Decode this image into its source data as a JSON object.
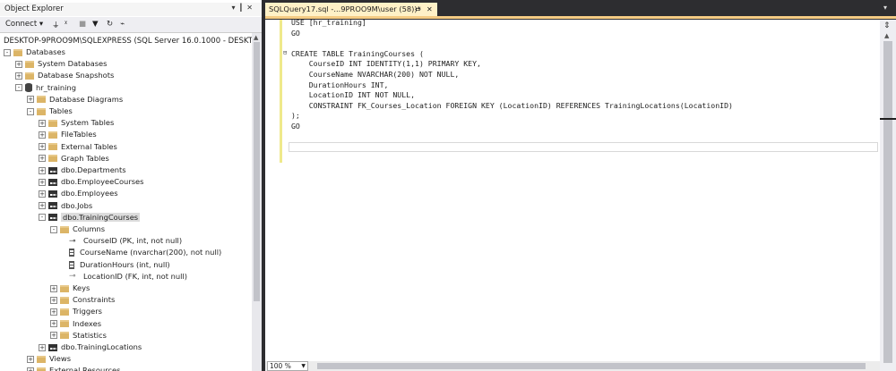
{
  "object_explorer": {
    "title": "Object Explorer",
    "title_buttons": [
      "▾",
      "📌",
      "✕"
    ],
    "toolbar": {
      "connect_label": "Connect ▾",
      "icons": [
        "connect-icon",
        "disconnect-icon",
        "stop-icon",
        "filter-icon",
        "refresh-icon",
        "activity-icon"
      ]
    },
    "server": "DESKTOP-9PROO9M\\SQLEXPRESS (SQL Server 16.0.1000 - DESKTOP-9P",
    "tree": [
      {
        "label": "Databases",
        "level": 0,
        "icon": "folder",
        "exp": "-"
      },
      {
        "label": "System Databases",
        "level": 1,
        "icon": "folder",
        "exp": "+"
      },
      {
        "label": "Database Snapshots",
        "level": 1,
        "icon": "folder",
        "exp": "+"
      },
      {
        "label": "hr_training",
        "level": 1,
        "icon": "database",
        "exp": "-"
      },
      {
        "label": "Database Diagrams",
        "level": 2,
        "icon": "folder",
        "exp": "+"
      },
      {
        "label": "Tables",
        "level": 2,
        "icon": "folder",
        "exp": "-"
      },
      {
        "label": "System Tables",
        "level": 3,
        "icon": "folder",
        "exp": "+"
      },
      {
        "label": "FileTables",
        "level": 3,
        "icon": "folder",
        "exp": "+"
      },
      {
        "label": "External Tables",
        "level": 3,
        "icon": "folder",
        "exp": "+"
      },
      {
        "label": "Graph Tables",
        "level": 3,
        "icon": "folder",
        "exp": "+"
      },
      {
        "label": "dbo.Departments",
        "level": 3,
        "icon": "table",
        "exp": "+"
      },
      {
        "label": "dbo.EmployeeCourses",
        "level": 3,
        "icon": "table",
        "exp": "+"
      },
      {
        "label": "dbo.Employees",
        "level": 3,
        "icon": "table",
        "exp": "+"
      },
      {
        "label": "dbo.Jobs",
        "level": 3,
        "icon": "table",
        "exp": "+"
      },
      {
        "label": "dbo.TrainingCourses",
        "level": 3,
        "icon": "table",
        "exp": "-",
        "selected": true
      },
      {
        "label": "Columns",
        "level": 4,
        "icon": "folder",
        "exp": "-"
      },
      {
        "label": "CourseID (PK, int, not null)",
        "level": 5,
        "icon": "pk",
        "exp": ""
      },
      {
        "label": "CourseName (nvarchar(200), not null)",
        "level": 5,
        "icon": "column",
        "exp": ""
      },
      {
        "label": "DurationHours (int, null)",
        "level": 5,
        "icon": "column",
        "exp": ""
      },
      {
        "label": "LocationID (FK, int, not null)",
        "level": 5,
        "icon": "fk",
        "exp": ""
      },
      {
        "label": "Keys",
        "level": 4,
        "icon": "folder",
        "exp": "+"
      },
      {
        "label": "Constraints",
        "level": 4,
        "icon": "folder",
        "exp": "+"
      },
      {
        "label": "Triggers",
        "level": 4,
        "icon": "folder",
        "exp": "+"
      },
      {
        "label": "Indexes",
        "level": 4,
        "icon": "folder",
        "exp": "+"
      },
      {
        "label": "Statistics",
        "level": 4,
        "icon": "folder",
        "exp": "+"
      },
      {
        "label": "dbo.TrainingLocations",
        "level": 3,
        "icon": "table",
        "exp": "+"
      },
      {
        "label": "Views",
        "level": 2,
        "icon": "folder",
        "exp": "+"
      },
      {
        "label": "External Resources",
        "level": 2,
        "icon": "folder",
        "exp": "+"
      }
    ]
  },
  "editor": {
    "tab_title": "SQLQuery17.sql -...9PROO9M\\user (58))*",
    "tab_pin": "⇔",
    "tab_close": "✕",
    "code_lines": [
      "USE [hr_training]",
      "GO",
      "",
      "CREATE TABLE TrainingCourses (",
      "    CourseID INT IDENTITY(1,1) PRIMARY KEY,",
      "    CourseName NVARCHAR(200) NOT NULL,",
      "    DurationHours INT,",
      "    LocationID INT NOT NULL,",
      "    CONSTRAINT FK_Courses_Location FOREIGN KEY (LocationID) REFERENCES TrainingLocations(LocationID)",
      ");",
      "GO",
      "",
      ""
    ],
    "zoom": "100 %"
  }
}
